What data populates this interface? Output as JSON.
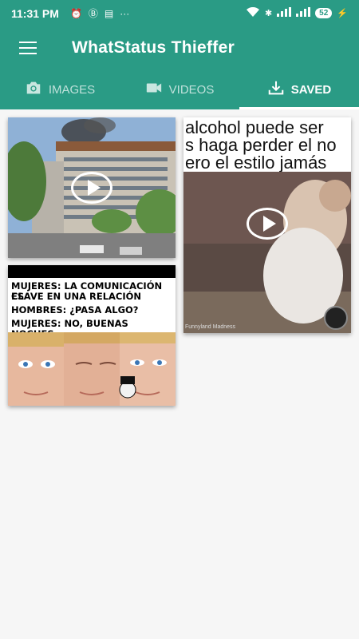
{
  "statusbar": {
    "time": "11:31 PM",
    "icons_left": [
      "alarm-icon",
      "b-icon",
      "news-icon",
      "more-dots-icon"
    ],
    "battery": "52"
  },
  "appbar": {
    "title": "WhatStatus Thieffer"
  },
  "tabs": [
    {
      "label": "IMAGES",
      "icon": "camera-icon",
      "active": false
    },
    {
      "label": "VIDEOS",
      "icon": "videocam-icon",
      "active": false
    },
    {
      "label": "SAVED",
      "icon": "download-icon",
      "active": true
    }
  ],
  "saved_items": {
    "video_building": {
      "type": "video"
    },
    "video_baby": {
      "type": "video",
      "caption_lines": [
        "alcohol puede ser",
        "s haga perder el no",
        "ero el estilo jamás"
      ],
      "watermark": "Funnyland Madness"
    },
    "meme_image": {
      "type": "image",
      "lines": [
        "MUJERES: LA COMUNICACIÓN ES",
        "CLAVE EN UNA RELACIÓN",
        "HOMBRES: ¿PASA ALGO?",
        "MUJERES: NO, BUENAS NOCHES"
      ]
    }
  },
  "colors": {
    "primary": "#2a9b85",
    "background": "#f6f6f6"
  }
}
